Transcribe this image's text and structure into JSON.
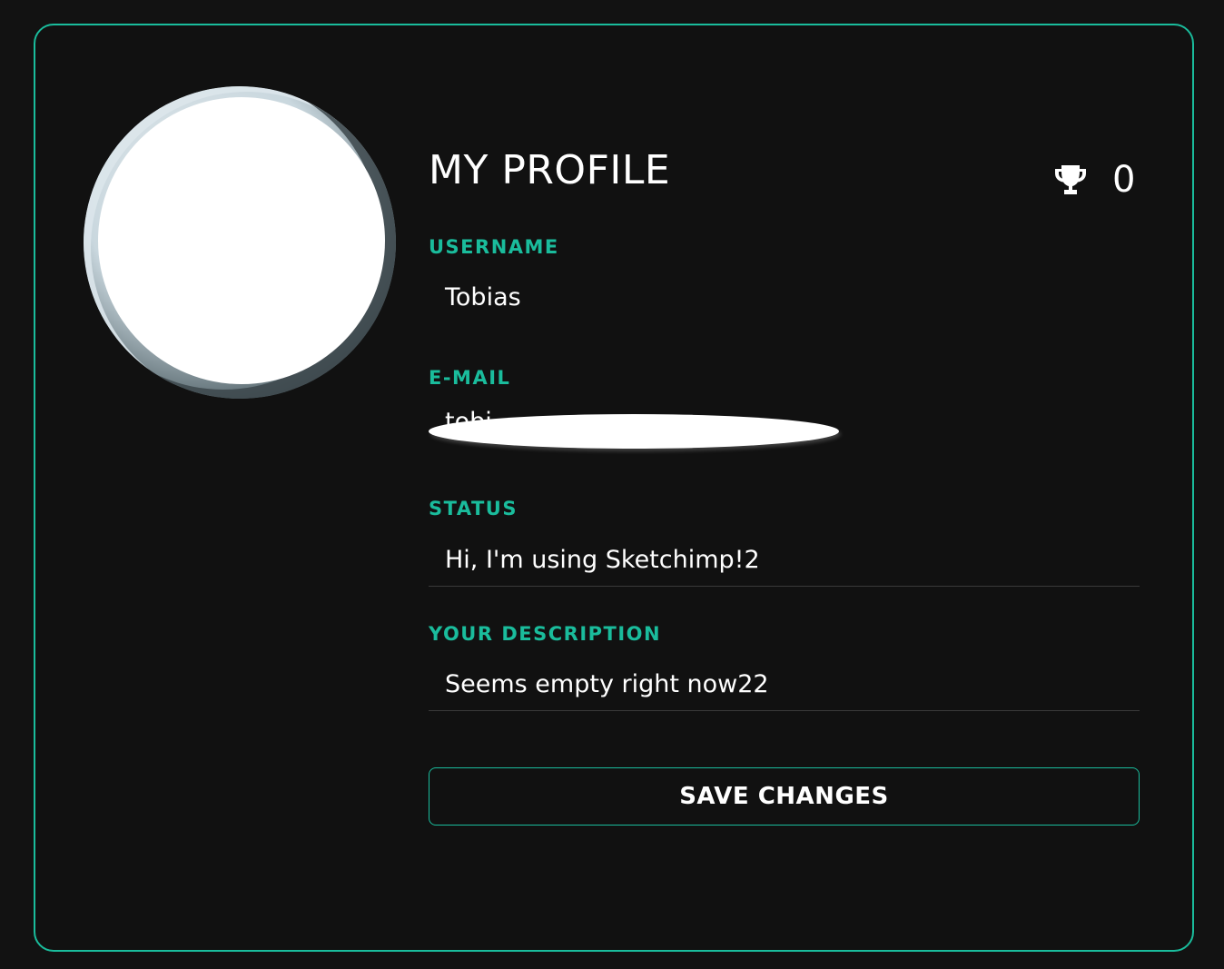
{
  "profile": {
    "title": "MY PROFILE",
    "trophy_count": "0",
    "trophy_icon": "trophy-icon"
  },
  "fields": {
    "username": {
      "label": "USERNAME",
      "value": "Tobias"
    },
    "email": {
      "label": "E-MAIL",
      "value": "tobi"
    },
    "status": {
      "label": "STATUS",
      "value": "Hi, I'm using Sketchimp!2"
    },
    "description": {
      "label": "YOUR DESCRIPTION",
      "value": "Seems empty right now22"
    }
  },
  "actions": {
    "save_label": "SAVE CHANGES"
  },
  "colors": {
    "accent": "#1abc9c",
    "background": "#121212",
    "text": "#ffffff"
  }
}
